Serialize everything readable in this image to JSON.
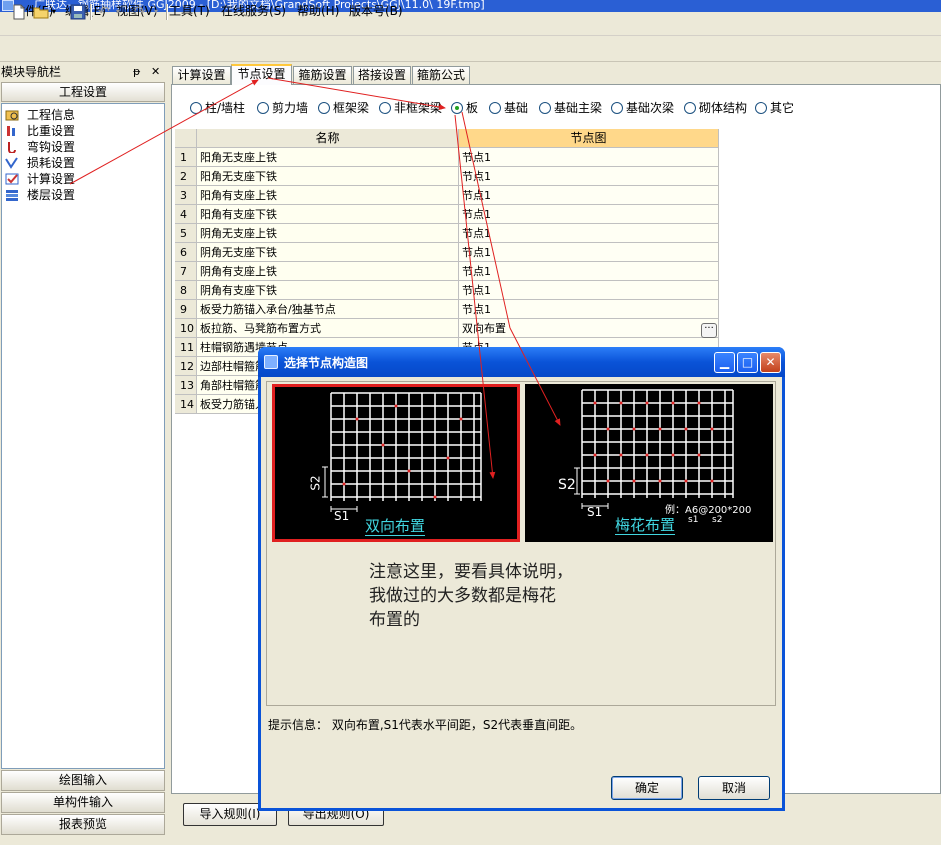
{
  "app": {
    "title": "广联达—钢筋抽样软件 GGJ2009 - [D:\\我的文档\\GrandSoft Projects\\GGJ\\11.0\\ 19F.tmp]"
  },
  "menu": [
    "文件(F)",
    "编辑(E)",
    "视图(V)",
    "工具(T)",
    "在线服务(S)",
    "帮助(H)",
    "版本号(B)"
  ],
  "nav": {
    "title": "模块导航栏",
    "pin": "ᵽ",
    "close": "✕",
    "section": "工程设置",
    "items": [
      "工程信息",
      "比重设置",
      "弯钩设置",
      "损耗设置",
      "计算设置",
      "楼层设置"
    ],
    "bottom": [
      "绘图输入",
      "单构件输入",
      "报表预览"
    ]
  },
  "tabs": [
    "计算设置",
    "节点设置",
    "箍筋设置",
    "搭接设置",
    "箍筋公式"
  ],
  "radios": [
    "柱/墙柱",
    "剪力墙",
    "框架梁",
    "非框架梁",
    "板",
    "基础",
    "基础主梁",
    "基础次梁",
    "砌体结构",
    "其它"
  ],
  "grid": {
    "headers": [
      "名称",
      "节点图"
    ],
    "rows": [
      {
        "n": "1",
        "name": "阳角无支座上铁",
        "val": "节点1"
      },
      {
        "n": "2",
        "name": "阳角无支座下铁",
        "val": "节点1"
      },
      {
        "n": "3",
        "name": "阳角有支座上铁",
        "val": "节点1"
      },
      {
        "n": "4",
        "name": "阳角有支座下铁",
        "val": "节点1"
      },
      {
        "n": "5",
        "name": "阴角无支座上铁",
        "val": "节点1"
      },
      {
        "n": "6",
        "name": "阴角无支座下铁",
        "val": "节点1"
      },
      {
        "n": "7",
        "name": "阴角有支座上铁",
        "val": "节点1"
      },
      {
        "n": "8",
        "name": "阴角有支座下铁",
        "val": "节点1"
      },
      {
        "n": "9",
        "name": "板受力筋锚入承台/独基节点",
        "val": "节点1"
      },
      {
        "n": "10",
        "name": "板拉筋、马凳筋布置方式",
        "val": "双向布置"
      },
      {
        "n": "11",
        "name": "柱帽钢筋遇墙节点",
        "val": "节点1"
      },
      {
        "n": "12",
        "name": "边部柱帽箍筋",
        "val": ""
      },
      {
        "n": "13",
        "name": "角部柱帽箍筋",
        "val": ""
      },
      {
        "n": "14",
        "name": "板受力筋锚入",
        "val": ""
      }
    ],
    "ellipsis": "···"
  },
  "bottom_buttons": [
    "导入规则(I)",
    "导出规则(O)"
  ],
  "dialog": {
    "title": "选择节点构造图",
    "images": [
      {
        "label": "双向布置",
        "s1": "S1",
        "s2": "S2"
      },
      {
        "label": "梅花布置",
        "s1": "S1",
        "s2": "S2",
        "example": "例：A6@200*200",
        "sub1": "s1",
        "sub2": "s2"
      }
    ],
    "note_lines": [
      "注意这里，要看具体说明，",
      "我做过的大多数都是梅花",
      "布置的"
    ],
    "hint": "提示信息： 双向布置,S1代表水平间距，S2代表垂直间距。",
    "ok": "确定",
    "cancel": "取消"
  },
  "colors": {
    "selection_border": "#e02020",
    "annotation_arrow": "#e02020",
    "label_cyan": "#41d6e0",
    "name_column_bg": "#fffff0",
    "value_column_bg": "#fffff4"
  }
}
